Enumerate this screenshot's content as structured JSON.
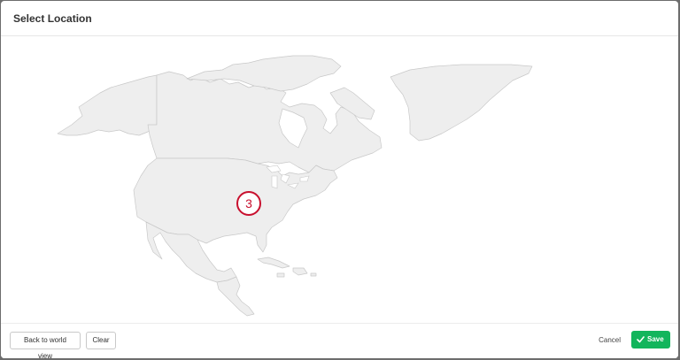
{
  "dialog": {
    "title": "Select Location"
  },
  "map": {
    "marker_count": "3",
    "land_color": "#eeeeee",
    "border_color": "#c8c8c8",
    "marker_color": "#c8102e"
  },
  "footer": {
    "back_label": "Back to world view",
    "clear_label": "Clear",
    "cancel_label": "Cancel",
    "save_label": "Save",
    "save_color": "#12b55c",
    "save_icon": "check-icon"
  }
}
